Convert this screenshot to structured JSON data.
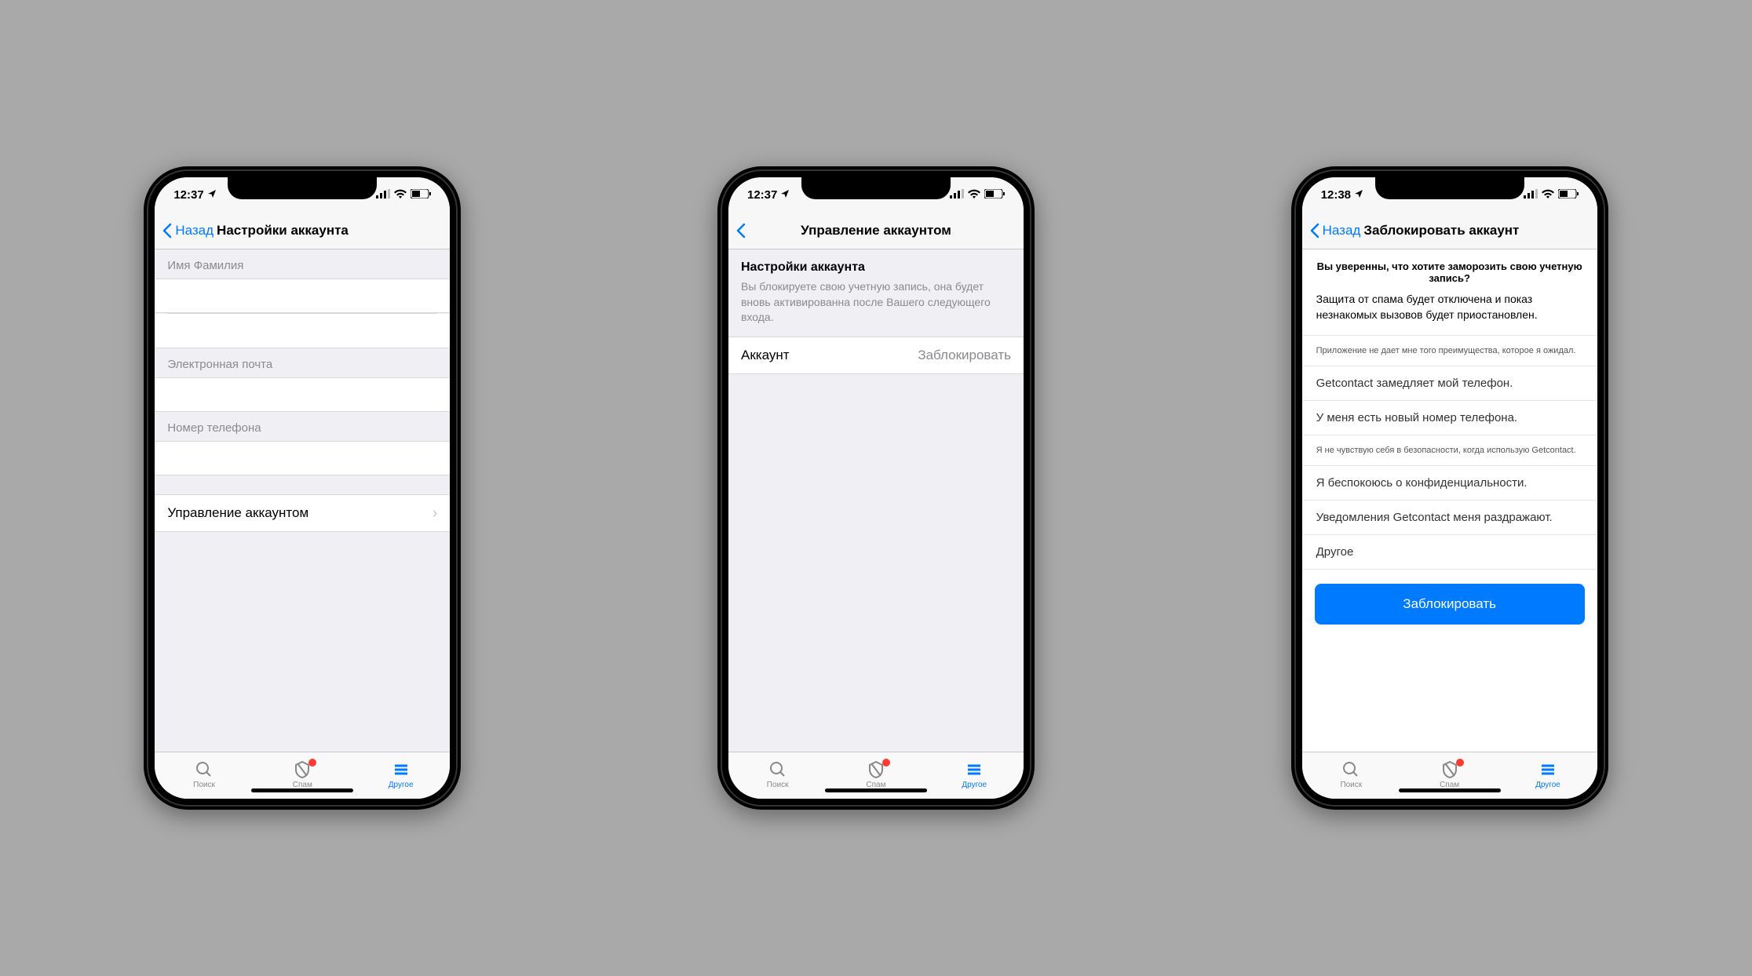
{
  "phone1": {
    "time": "12:37",
    "back_label": "Назад",
    "title": "Настройки аккаунта",
    "field_name": "Имя Фамилия",
    "field_email": "Электронная почта",
    "field_phone": "Номер телефона",
    "manage_account": "Управление аккаунтом"
  },
  "phone2": {
    "time": "12:37",
    "title": "Управление аккаунтом",
    "section_title": "Настройки аккаунта",
    "section_desc": "Вы блокируете свою учетную запись, она будет вновь активированна после Вашего следующего входа.",
    "row_key": "Аккаунт",
    "row_value": "Заблокировать"
  },
  "phone3": {
    "time": "12:38",
    "back_label": "Назад",
    "title": "Заблокировать аккаунт",
    "question": "Вы уверенны, что хотите заморозить свою учетную запись?",
    "warning": "Защита от спама будет отключена и показ незнакомых вызовов будет приостановлен.",
    "reasons": [
      "Приложение не дает мне того преимущества, которое я ожидал.",
      "Getcontact замедляет мой телефон.",
      "У меня есть новый номер телефона.",
      "Я не чувствую себя в безопасности, когда использую Getcontact.",
      "Я беспокоюсь о конфиденциальности.",
      "Уведомления Getcontact меня раздражают.",
      "Другое"
    ],
    "block_button": "Заблокировать"
  },
  "tabs": {
    "search": "Поиск",
    "spam": "Спам",
    "other": "Другое"
  }
}
